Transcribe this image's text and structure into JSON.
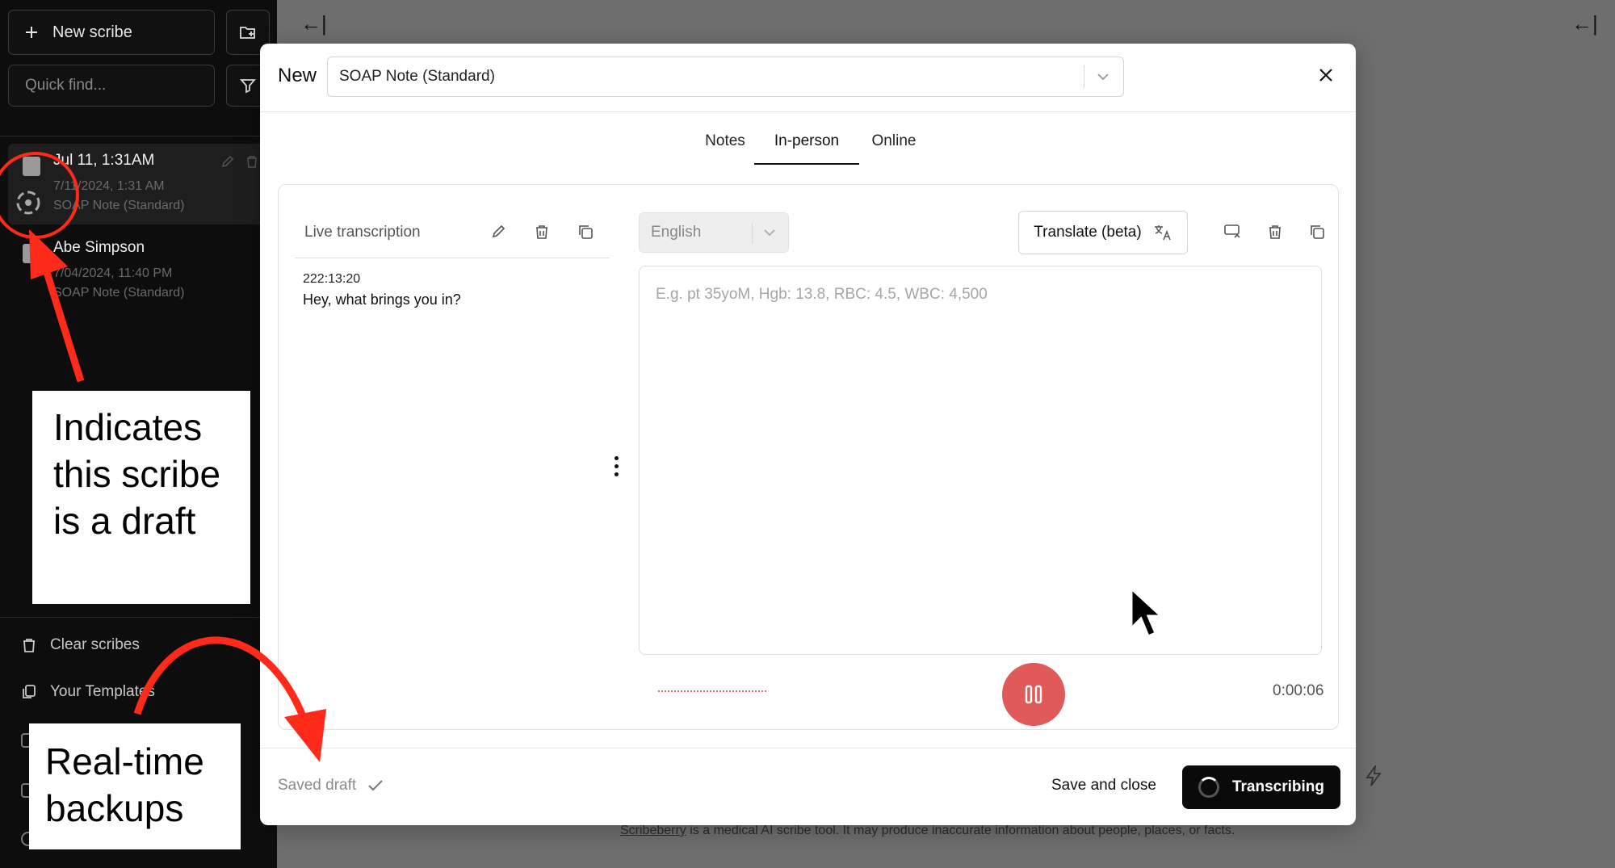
{
  "sidebar": {
    "new_scribe_label": "New scribe",
    "quick_find_placeholder": "Quick find...",
    "scribes": [
      {
        "title": "Jul 11, 1:31AM",
        "date": "7/11/2024, 1:31 AM",
        "template": "SOAP Note (Standard)"
      },
      {
        "title": "Abe Simpson",
        "date": "7/04/2024, 11:40 PM",
        "template": "SOAP Note (Standard)"
      }
    ],
    "menu": [
      {
        "label": "Clear scribes",
        "icon": "trash-icon"
      },
      {
        "label": "Your Templates",
        "icon": "templates-icon"
      }
    ]
  },
  "modal": {
    "title": "New",
    "template_value": "SOAP Note (Standard)",
    "tabs": [
      "Notes",
      "In-person",
      "Online"
    ],
    "active_tab": "In-person",
    "live_transcription": {
      "title": "Live transcription",
      "timestamp": "222:13:20",
      "text": "Hey, what brings you in?"
    },
    "notes": {
      "language": "English",
      "translate_label": "Translate (beta)",
      "placeholder": "E.g. pt 35yoM, Hgb: 13.8, RBC: 4.5, WBC: 4,500"
    },
    "recording": {
      "timer": "0:00:06",
      "pause_color": "#e05a5a"
    },
    "footer": {
      "saved_draft": "Saved draft",
      "save_close": "Save and close",
      "transcribing": "Transcribing"
    }
  },
  "background": {
    "footer_brand": "Scribeberry",
    "footer_text": " is a medical AI scribe tool. It may produce inaccurate information about people, places, or facts."
  },
  "annotations": {
    "draft_note": "Indicates this scribe is a draft",
    "backup_note": "Real-time backups",
    "arrow_color": "#ff2a1a"
  }
}
